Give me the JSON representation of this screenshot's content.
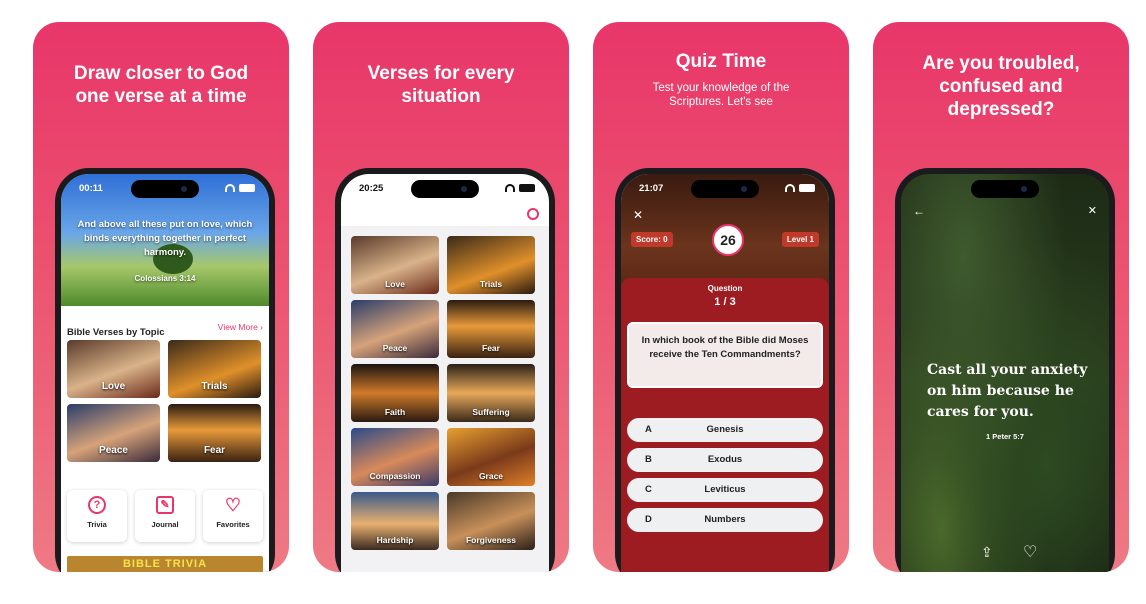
{
  "colors": {
    "accent": "#e8366a",
    "quiz_red": "#9d1c22",
    "badge_red": "#c0392b"
  },
  "card1": {
    "title": "Draw closer to God one verse at a time",
    "time": "00:11",
    "hero_verse": "And above all these put on love, which binds everything together in perfect harmony.",
    "hero_ref": "Colossians 3:14",
    "section_title": "Bible Verses by Topic",
    "view_more": "View More ›",
    "topics": [
      "Love",
      "Trials",
      "Peace",
      "Fear"
    ],
    "actions": [
      {
        "label": "Trivia",
        "icon": "question-icon"
      },
      {
        "label": "Journal",
        "icon": "edit-icon"
      },
      {
        "label": "Favorites",
        "icon": "heart-icon"
      }
    ],
    "banner": "BIBLE TRIVIA"
  },
  "card2": {
    "title": "Verses for every situation",
    "time": "20:25",
    "topics": [
      "Love",
      "Trials",
      "Peace",
      "Fear",
      "Faith",
      "Suffering",
      "Compassion",
      "Grace",
      "Hardship",
      "Forgiveness"
    ]
  },
  "card3": {
    "title": "Quiz Time",
    "subtitle": "Test your knowledge of the Scriptures. Let's see",
    "time": "21:07",
    "close": "✕",
    "score": "Score: 0",
    "timer": "26",
    "level": "Level 1",
    "question_label": "Question",
    "question_count": "1 / 3",
    "question": "In which book of the Bible did Moses receive the Ten Commandments?",
    "answers": [
      {
        "key": "A",
        "text": "Genesis"
      },
      {
        "key": "B",
        "text": "Exodus"
      },
      {
        "key": "C",
        "text": "Leviticus"
      },
      {
        "key": "D",
        "text": "Numbers"
      }
    ]
  },
  "card4": {
    "title": "Are you troubled, confused and depressed?",
    "back": "←",
    "mute": "✕",
    "verse": "Cast all your anxiety on him because he cares for you.",
    "ref": "1 Peter 5:7",
    "share": "⇪",
    "heart": "♡"
  }
}
